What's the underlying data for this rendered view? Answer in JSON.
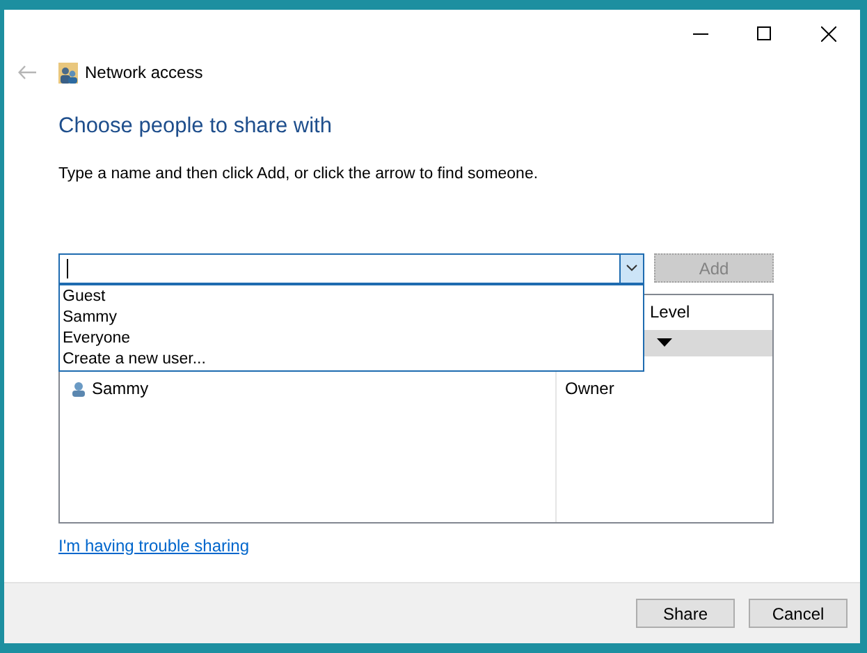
{
  "window": {
    "title": "Network access"
  },
  "heading": "Choose people to share with",
  "instruction": "Type a name and then click Add, or click the arrow to find someone.",
  "name_combo": {
    "focused": true,
    "expanded": true,
    "options": [
      "Guest",
      "Sammy",
      "Everyone",
      "Create a new user..."
    ]
  },
  "add_button": {
    "label": "Add",
    "disabled": true
  },
  "sharing_list": {
    "columns": [
      {
        "label": "Level"
      }
    ],
    "rows": [
      {
        "selected": true
      },
      {
        "name": "Sammy",
        "level": "Owner",
        "selected": false
      }
    ]
  },
  "help_link": "I'm having trouble sharing",
  "buttons": [
    "Share",
    "Cancel"
  ]
}
